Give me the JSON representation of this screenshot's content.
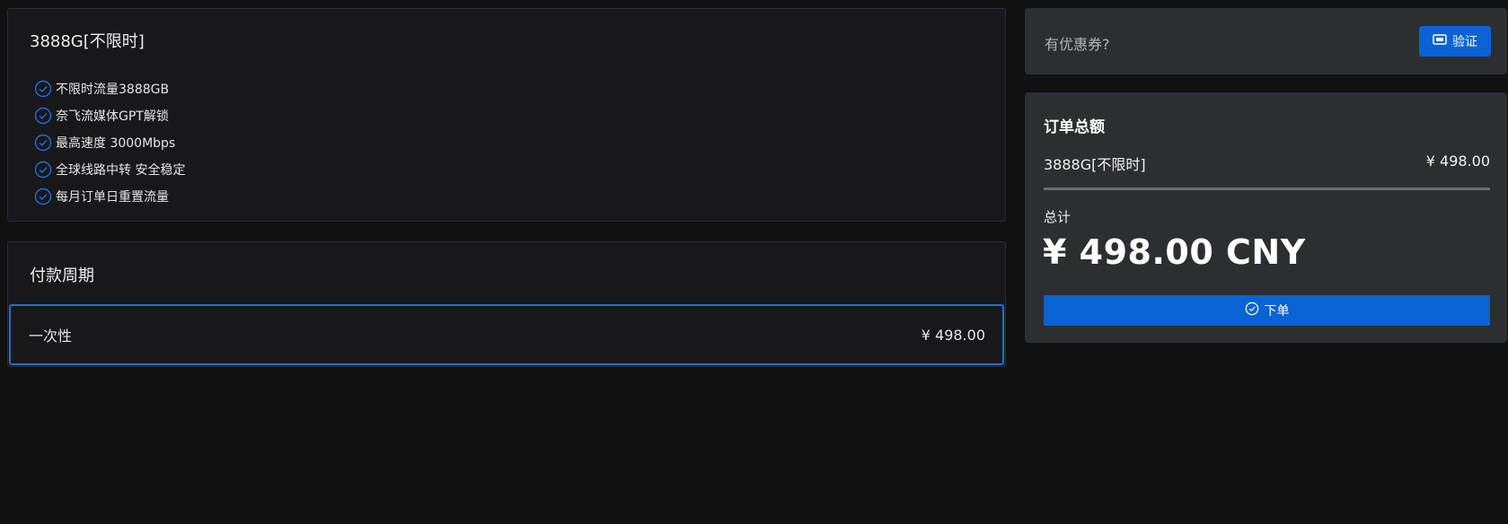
{
  "plan": {
    "title": "3888G[不限时]",
    "features": [
      "不限时流量3888GB",
      "奈飞流媒体GPT解锁",
      "最高速度 3000Mbps",
      "全球线路中转 安全稳定",
      "每月订单日重置流量"
    ],
    "feature_icon": "check-circle-icon"
  },
  "cycle": {
    "title": "付款周期",
    "option_label": "一次性",
    "option_price": "¥ 498.00"
  },
  "coupon": {
    "label": "有优惠券?",
    "button_label": "验证",
    "button_icon": "ticket-icon"
  },
  "order": {
    "title": "订单总额",
    "item_name": "3888G[不限时]",
    "item_price": "¥ 498.00",
    "total_label": "总计",
    "total_amount": "¥ 498.00 CNY",
    "button_label": "下单",
    "button_icon": "check-circle-icon"
  },
  "colors": {
    "accent": "#0a63d3",
    "selected_border": "#1f6fd4",
    "panel_dark": "#18181c",
    "panel_gray": "#2d2e32",
    "background": "#111112"
  }
}
